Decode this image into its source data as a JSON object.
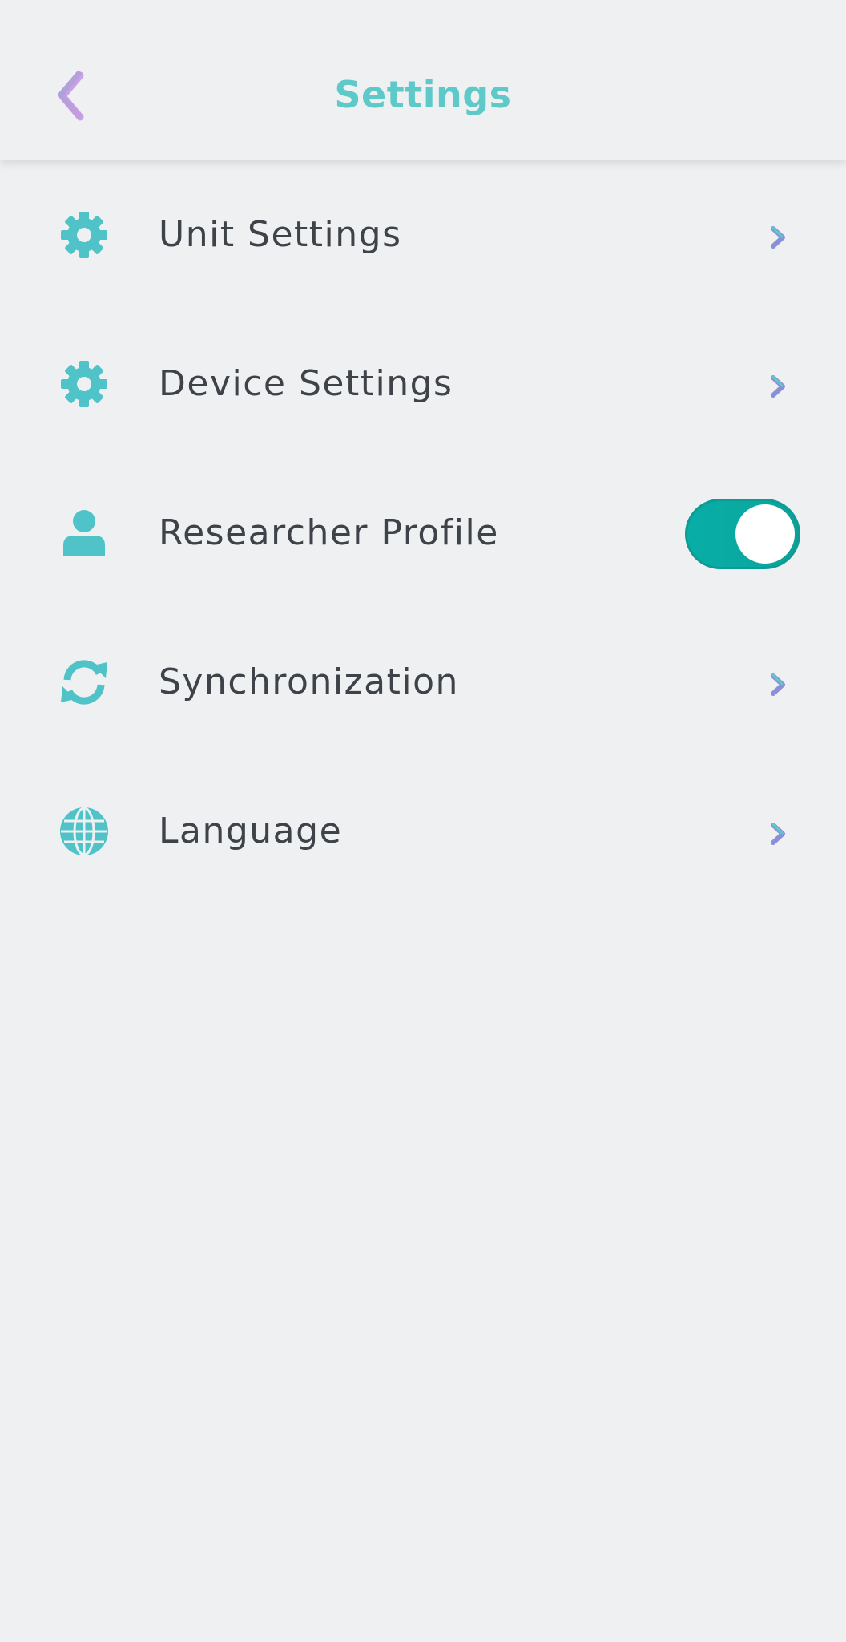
{
  "header": {
    "title": "Settings",
    "back_icon": "chevron-left-icon"
  },
  "colors": {
    "accent": "#5ec9c9",
    "icon": "#4fc3c7",
    "toggle_on": "#08aea6",
    "chevron": "#8a8fd8",
    "text": "#3d4348",
    "background": "#eef0f2"
  },
  "settings": {
    "items": [
      {
        "label": "Unit Settings",
        "icon": "gear-icon",
        "control": "chevron"
      },
      {
        "label": "Device Settings",
        "icon": "gear-icon",
        "control": "chevron"
      },
      {
        "label": "Researcher Profile",
        "icon": "user-icon",
        "control": "toggle",
        "toggle_on": true
      },
      {
        "label": "Synchronization",
        "icon": "sync-icon",
        "control": "chevron"
      },
      {
        "label": "Language",
        "icon": "globe-icon",
        "control": "chevron"
      }
    ]
  }
}
